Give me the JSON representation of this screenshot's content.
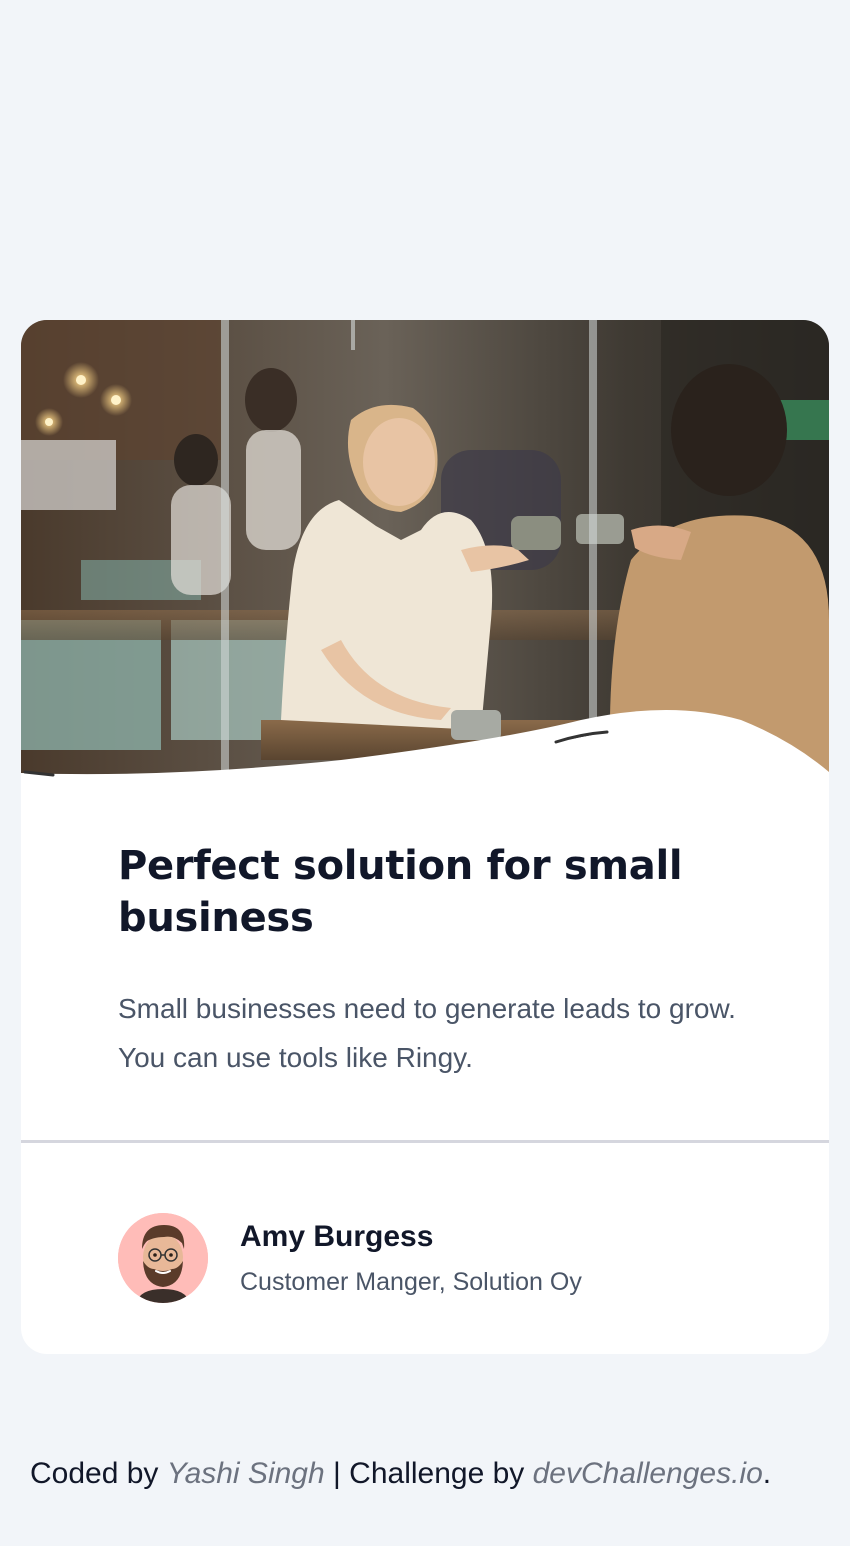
{
  "card": {
    "image_alt": "People meeting in a cafe",
    "title": "Perfect solution for small business",
    "description": "Small businesses need to generate leads to grow. You can use tools like Ringy.",
    "author": {
      "name": "Amy Burgess",
      "role": "Customer Manger, Solution Oy",
      "avatar_bg": "#ffbcb8"
    }
  },
  "footer": {
    "coded_by_prefix": "Coded by",
    "author_link": "Yashi Singh",
    "separator": "|",
    "challenge_prefix": "Challenge by",
    "challenge_link": "devChallenges.io",
    "suffix": "."
  },
  "colors": {
    "page_bg": "#f2f5f9",
    "card_bg": "#ffffff",
    "title": "#111729",
    "body_text": "#4a5567",
    "link": "#6c727f",
    "divider": "#d5d6de"
  }
}
